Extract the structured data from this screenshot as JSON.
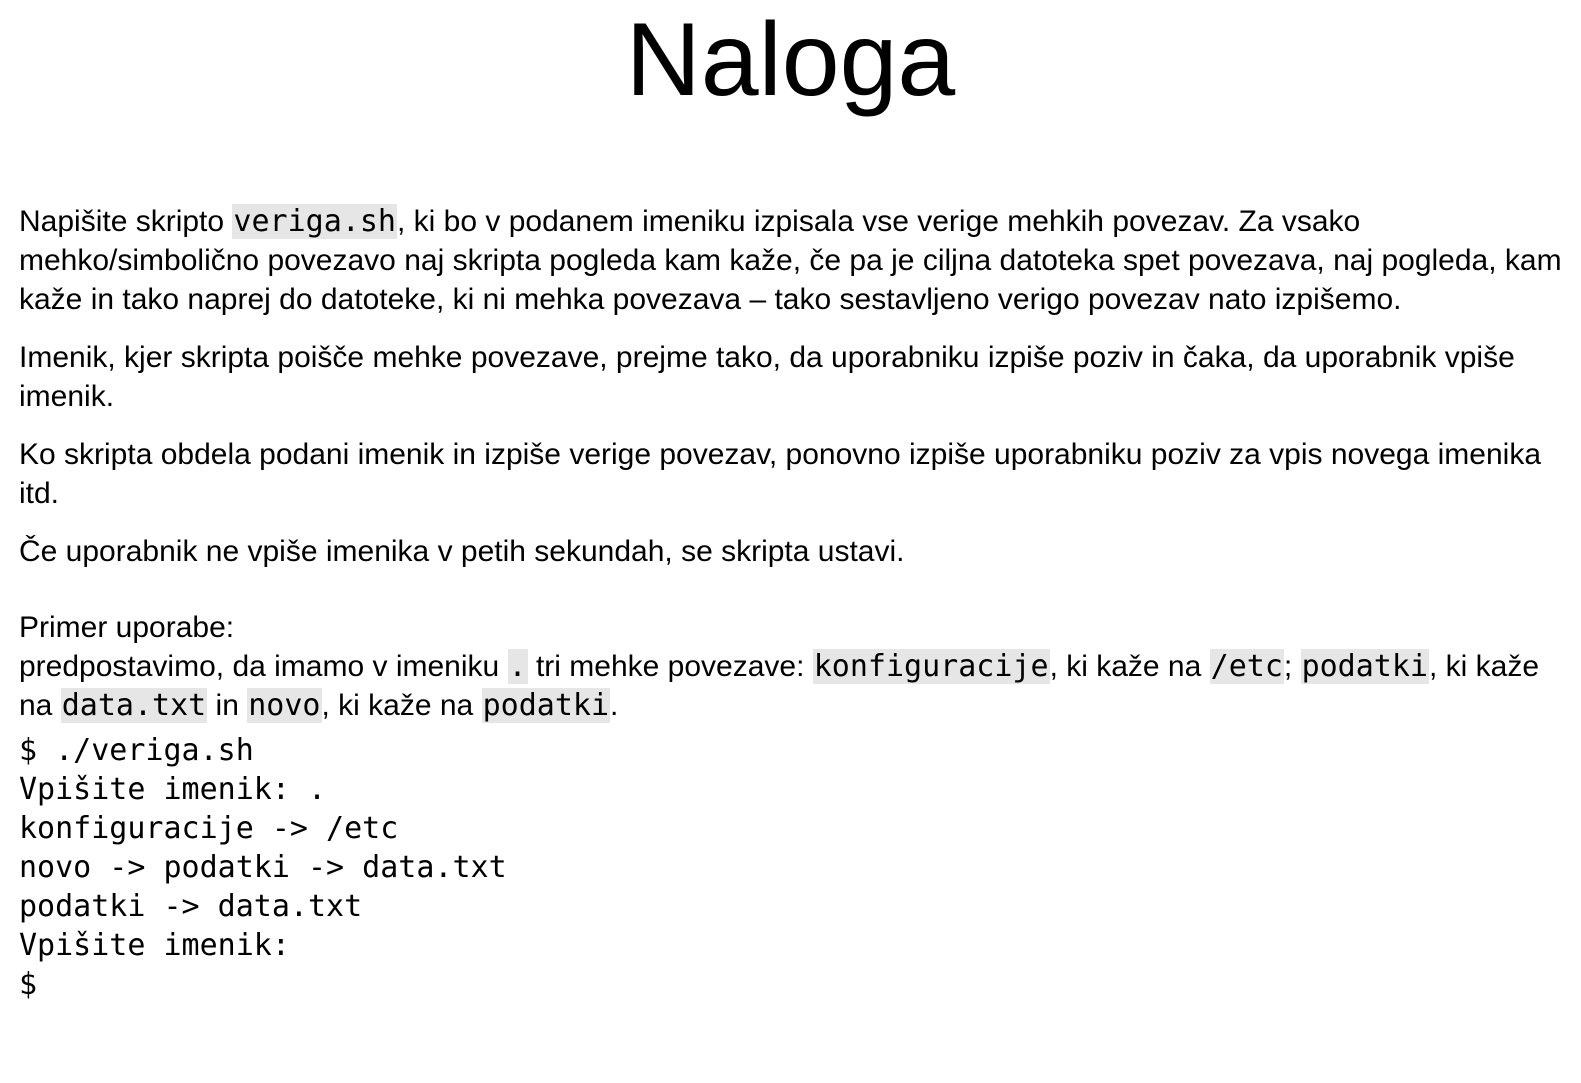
{
  "title": "Naloga",
  "paragraphs": {
    "p1": {
      "t1": "Napišite skripto ",
      "c1": "veriga.sh",
      "t2": ", ki bo v podanem imeniku izpisala vse verige mehkih povezav. Za vsako mehko/simbolično povezavo naj skripta pogleda kam kaže, če pa je ciljna datoteka spet povezava, naj pogleda, kam kaže in tako naprej do datoteke, ki ni mehka povezava – tako sestavljeno verigo povezav nato izpišemo."
    },
    "p2": "Imenik, kjer skripta poišče mehke povezave, prejme tako, da uporabniku izpiše poziv in čaka, da uporabnik vpiše imenik.",
    "p3": "Ko skripta obdela podani imenik in izpiše verige povezav, ponovno izpiše uporabniku poziv za vpis novega imenika itd.",
    "p4": "Če uporabnik ne vpiše imenika v petih sekundah, se skripta ustavi."
  },
  "example": {
    "heading": "Primer uporabe:",
    "t1": "predpostavimo, da imamo v imeniku ",
    "c1": ".",
    "t2": " tri mehke povezave: ",
    "c2": "konfiguracije",
    "t3": ", ki kaže na ",
    "c3": "/etc",
    "t4": "; ",
    "c4": "podatki",
    "t5": ", ki kaže na ",
    "c5": "data.txt",
    "t6": " in ",
    "c6": "novo",
    "t7": ", ki kaže na ",
    "c7": "podatki",
    "t8": "."
  },
  "terminal": {
    "lines": [
      "$ ./veriga.sh",
      "Vpišite imenik: .",
      "konfiguracije -> /etc",
      "novo -> podatki -> data.txt",
      "podatki -> data.txt",
      "Vpišite imenik:",
      "$"
    ]
  }
}
